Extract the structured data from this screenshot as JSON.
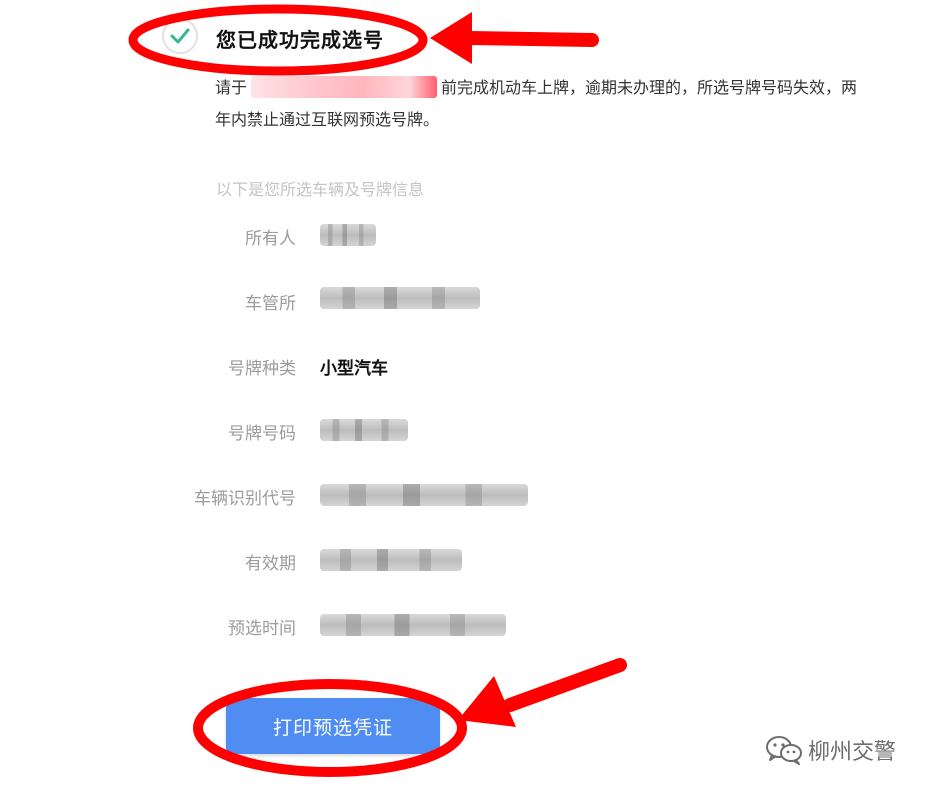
{
  "success": {
    "title": "您已成功完成选号"
  },
  "notice": {
    "prefix": "请于",
    "suffix": "前完成机动车上牌，逾期未办理的，所选号牌号码失效，两年内禁止通过互联网预选号牌。"
  },
  "info": {
    "section_hint": "以下是您所选车辆及号牌信息",
    "rows": [
      {
        "label": "所有人",
        "value": null
      },
      {
        "label": "车管所",
        "value": null
      },
      {
        "label": "号牌种类",
        "value": "小型汽车"
      },
      {
        "label": "号牌号码",
        "value": null
      },
      {
        "label": "车辆识别代号",
        "value": null
      },
      {
        "label": "有效期",
        "value": null
      },
      {
        "label": "预选时间",
        "value": null
      }
    ]
  },
  "actions": {
    "print_label": "打印预选凭证"
  },
  "watermark": {
    "text": "柳州交警",
    "icon": "wechat-icon"
  },
  "colors": {
    "button_blue": "#4f8df2",
    "annotation_red": "#ff0000",
    "check_green": "#39b98b",
    "label_gray": "#9c9c9c"
  }
}
